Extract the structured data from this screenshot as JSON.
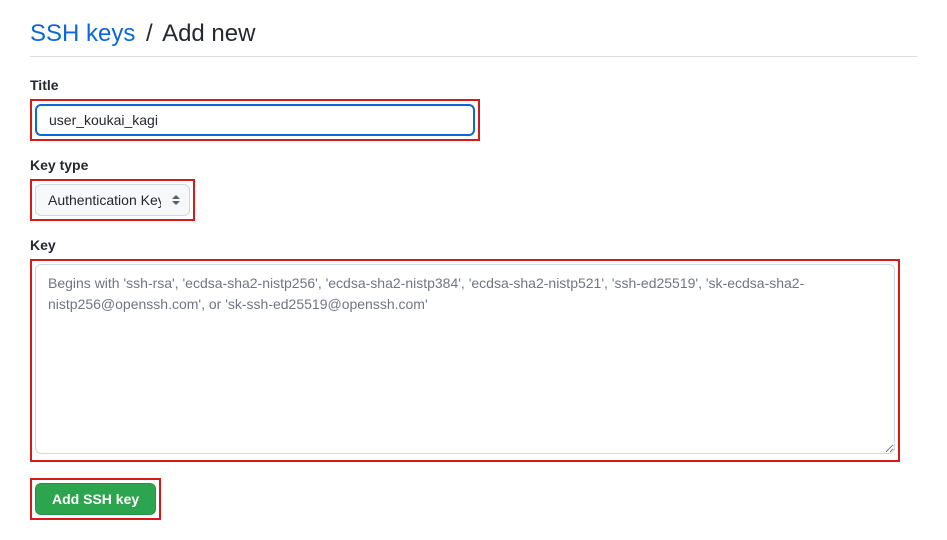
{
  "breadcrumb": {
    "link_text": "SSH keys",
    "separator": "/",
    "current": "Add new"
  },
  "form": {
    "title_label": "Title",
    "title_value": "user_koukai_kagi",
    "keytype_label": "Key type",
    "keytype_value": "Authentication Key",
    "key_label": "Key",
    "key_value": "",
    "key_placeholder": "Begins with 'ssh-rsa', 'ecdsa-sha2-nistp256', 'ecdsa-sha2-nistp384', 'ecdsa-sha2-nistp521', 'ssh-ed25519', 'sk-ecdsa-sha2-nistp256@openssh.com', or 'sk-ssh-ed25519@openssh.com'",
    "submit_label": "Add SSH key"
  }
}
